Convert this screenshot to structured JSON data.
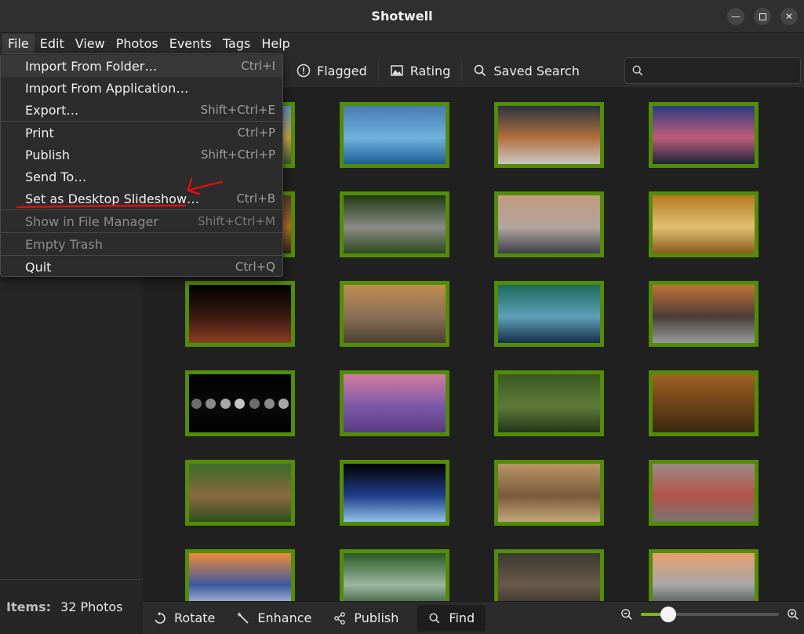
{
  "window": {
    "title": "Shotwell"
  },
  "menubar": [
    "File",
    "Edit",
    "View",
    "Photos",
    "Events",
    "Tags",
    "Help"
  ],
  "file_menu": {
    "groups": [
      [
        {
          "label": "Import From Folder…",
          "accel": "Ctrl+I"
        },
        {
          "label": "Import From Application…",
          "accel": ""
        },
        {
          "label": "Export…",
          "accel": "Shift+Ctrl+E"
        }
      ],
      [
        {
          "label": "Print",
          "accel": "Ctrl+P"
        },
        {
          "label": "Publish",
          "accel": "Shift+Ctrl+P"
        },
        {
          "label": "Send To…",
          "accel": ""
        },
        {
          "label": "Set as Desktop Slideshow…",
          "accel": "Ctrl+B"
        }
      ],
      [
        {
          "label": "Show in File Manager",
          "accel": "Shift+Ctrl+M",
          "disabled": true
        }
      ],
      [
        {
          "label": "Empty Trash",
          "accel": "",
          "disabled": true
        }
      ],
      [
        {
          "label": "Quit",
          "accel": "Ctrl+Q"
        }
      ]
    ]
  },
  "filterbar": {
    "flagged": "Flagged",
    "rating": "Rating",
    "saved_search": "Saved Search",
    "search_placeholder": ""
  },
  "sidebar": {
    "items_label": "Items:",
    "items_value": "32 Photos"
  },
  "bottombar": {
    "rotate": "Rotate",
    "enhance": "Enhance",
    "publish": "Publish",
    "find": "Find",
    "zoom_level": 0.2
  },
  "colors": {
    "thumb_border": "#528c09",
    "slider_fill": "#79b51d",
    "annotation": "#e01010"
  },
  "photos": [
    {
      "name": "photo-coast",
      "g": [
        "#5a8fbd",
        "#c8a04a",
        "#3e5a2a"
      ]
    },
    {
      "name": "photo-lake-island",
      "g": [
        "#4a7bb3",
        "#6fb2dc",
        "#1d5f95"
      ]
    },
    {
      "name": "photo-mountain-sunset",
      "g": [
        "#2a3340",
        "#b3703e",
        "#c9c6c4"
      ]
    },
    {
      "name": "photo-purple-lake",
      "g": [
        "#2b3b80",
        "#c05c7a",
        "#1b2438"
      ]
    },
    {
      "name": "photo-autumn-forest",
      "g": [
        "#4f3a22",
        "#b06b2c",
        "#2f2618"
      ]
    },
    {
      "name": "photo-koala",
      "g": [
        "#1f3a14",
        "#8b8b85",
        "#2b4a1a"
      ]
    },
    {
      "name": "photo-city-reflection",
      "g": [
        "#c49a7e",
        "#b1a49e",
        "#3b4048"
      ]
    },
    {
      "name": "photo-dandelion",
      "g": [
        "#b87a23",
        "#e0c070",
        "#8a5a1b"
      ]
    },
    {
      "name": "photo-mars",
      "g": [
        "#000000",
        "#3a1a10",
        "#8b3e24"
      ]
    },
    {
      "name": "photo-valley-sunrise",
      "g": [
        "#c08c50",
        "#8a6f56",
        "#4a4030"
      ]
    },
    {
      "name": "photo-aurora-waterfall",
      "g": [
        "#1b6b5a",
        "#5fa0b8",
        "#133046"
      ]
    },
    {
      "name": "photo-japanese-garden",
      "g": [
        "#c2723a",
        "#4a3e36",
        "#9a9a9a"
      ]
    },
    {
      "name": "photo-moon-phases",
      "g": [
        "#000000",
        "#0a0a0a",
        "#000000"
      ]
    },
    {
      "name": "photo-lavender",
      "g": [
        "#d27aa0",
        "#7a5aa8",
        "#5a3a80"
      ]
    },
    {
      "name": "photo-forest-waterfall",
      "g": [
        "#3a5a22",
        "#5f7a3a",
        "#24351a"
      ]
    },
    {
      "name": "photo-deer-forest",
      "g": [
        "#a0621f",
        "#6a4018",
        "#3a2a12"
      ]
    },
    {
      "name": "photo-boardwalk",
      "g": [
        "#3d6a2a",
        "#8a6a3e",
        "#2e4e1e"
      ]
    },
    {
      "name": "photo-earth-orbit",
      "g": [
        "#000000",
        "#1f3d8a",
        "#8fc2ea"
      ]
    },
    {
      "name": "photo-squirrels",
      "g": [
        "#b89664",
        "#7a5a3a",
        "#c4a57a"
      ]
    },
    {
      "name": "photo-waxwing",
      "g": [
        "#9a8a86",
        "#b5524a",
        "#7a7370"
      ]
    },
    {
      "name": "photo-santorini",
      "g": [
        "#f08a3a",
        "#3a5aa0",
        "#d8dde6"
      ]
    },
    {
      "name": "photo-jungle-falls",
      "g": [
        "#2a5a24",
        "#9ab8a0",
        "#24421c"
      ]
    },
    {
      "name": "photo-squirrel-branch",
      "g": [
        "#3a3a30",
        "#6a5a4a",
        "#2a2a22"
      ]
    },
    {
      "name": "photo-mountain-lake",
      "g": [
        "#e8a070",
        "#a6a6a6",
        "#3a4040"
      ]
    }
  ]
}
